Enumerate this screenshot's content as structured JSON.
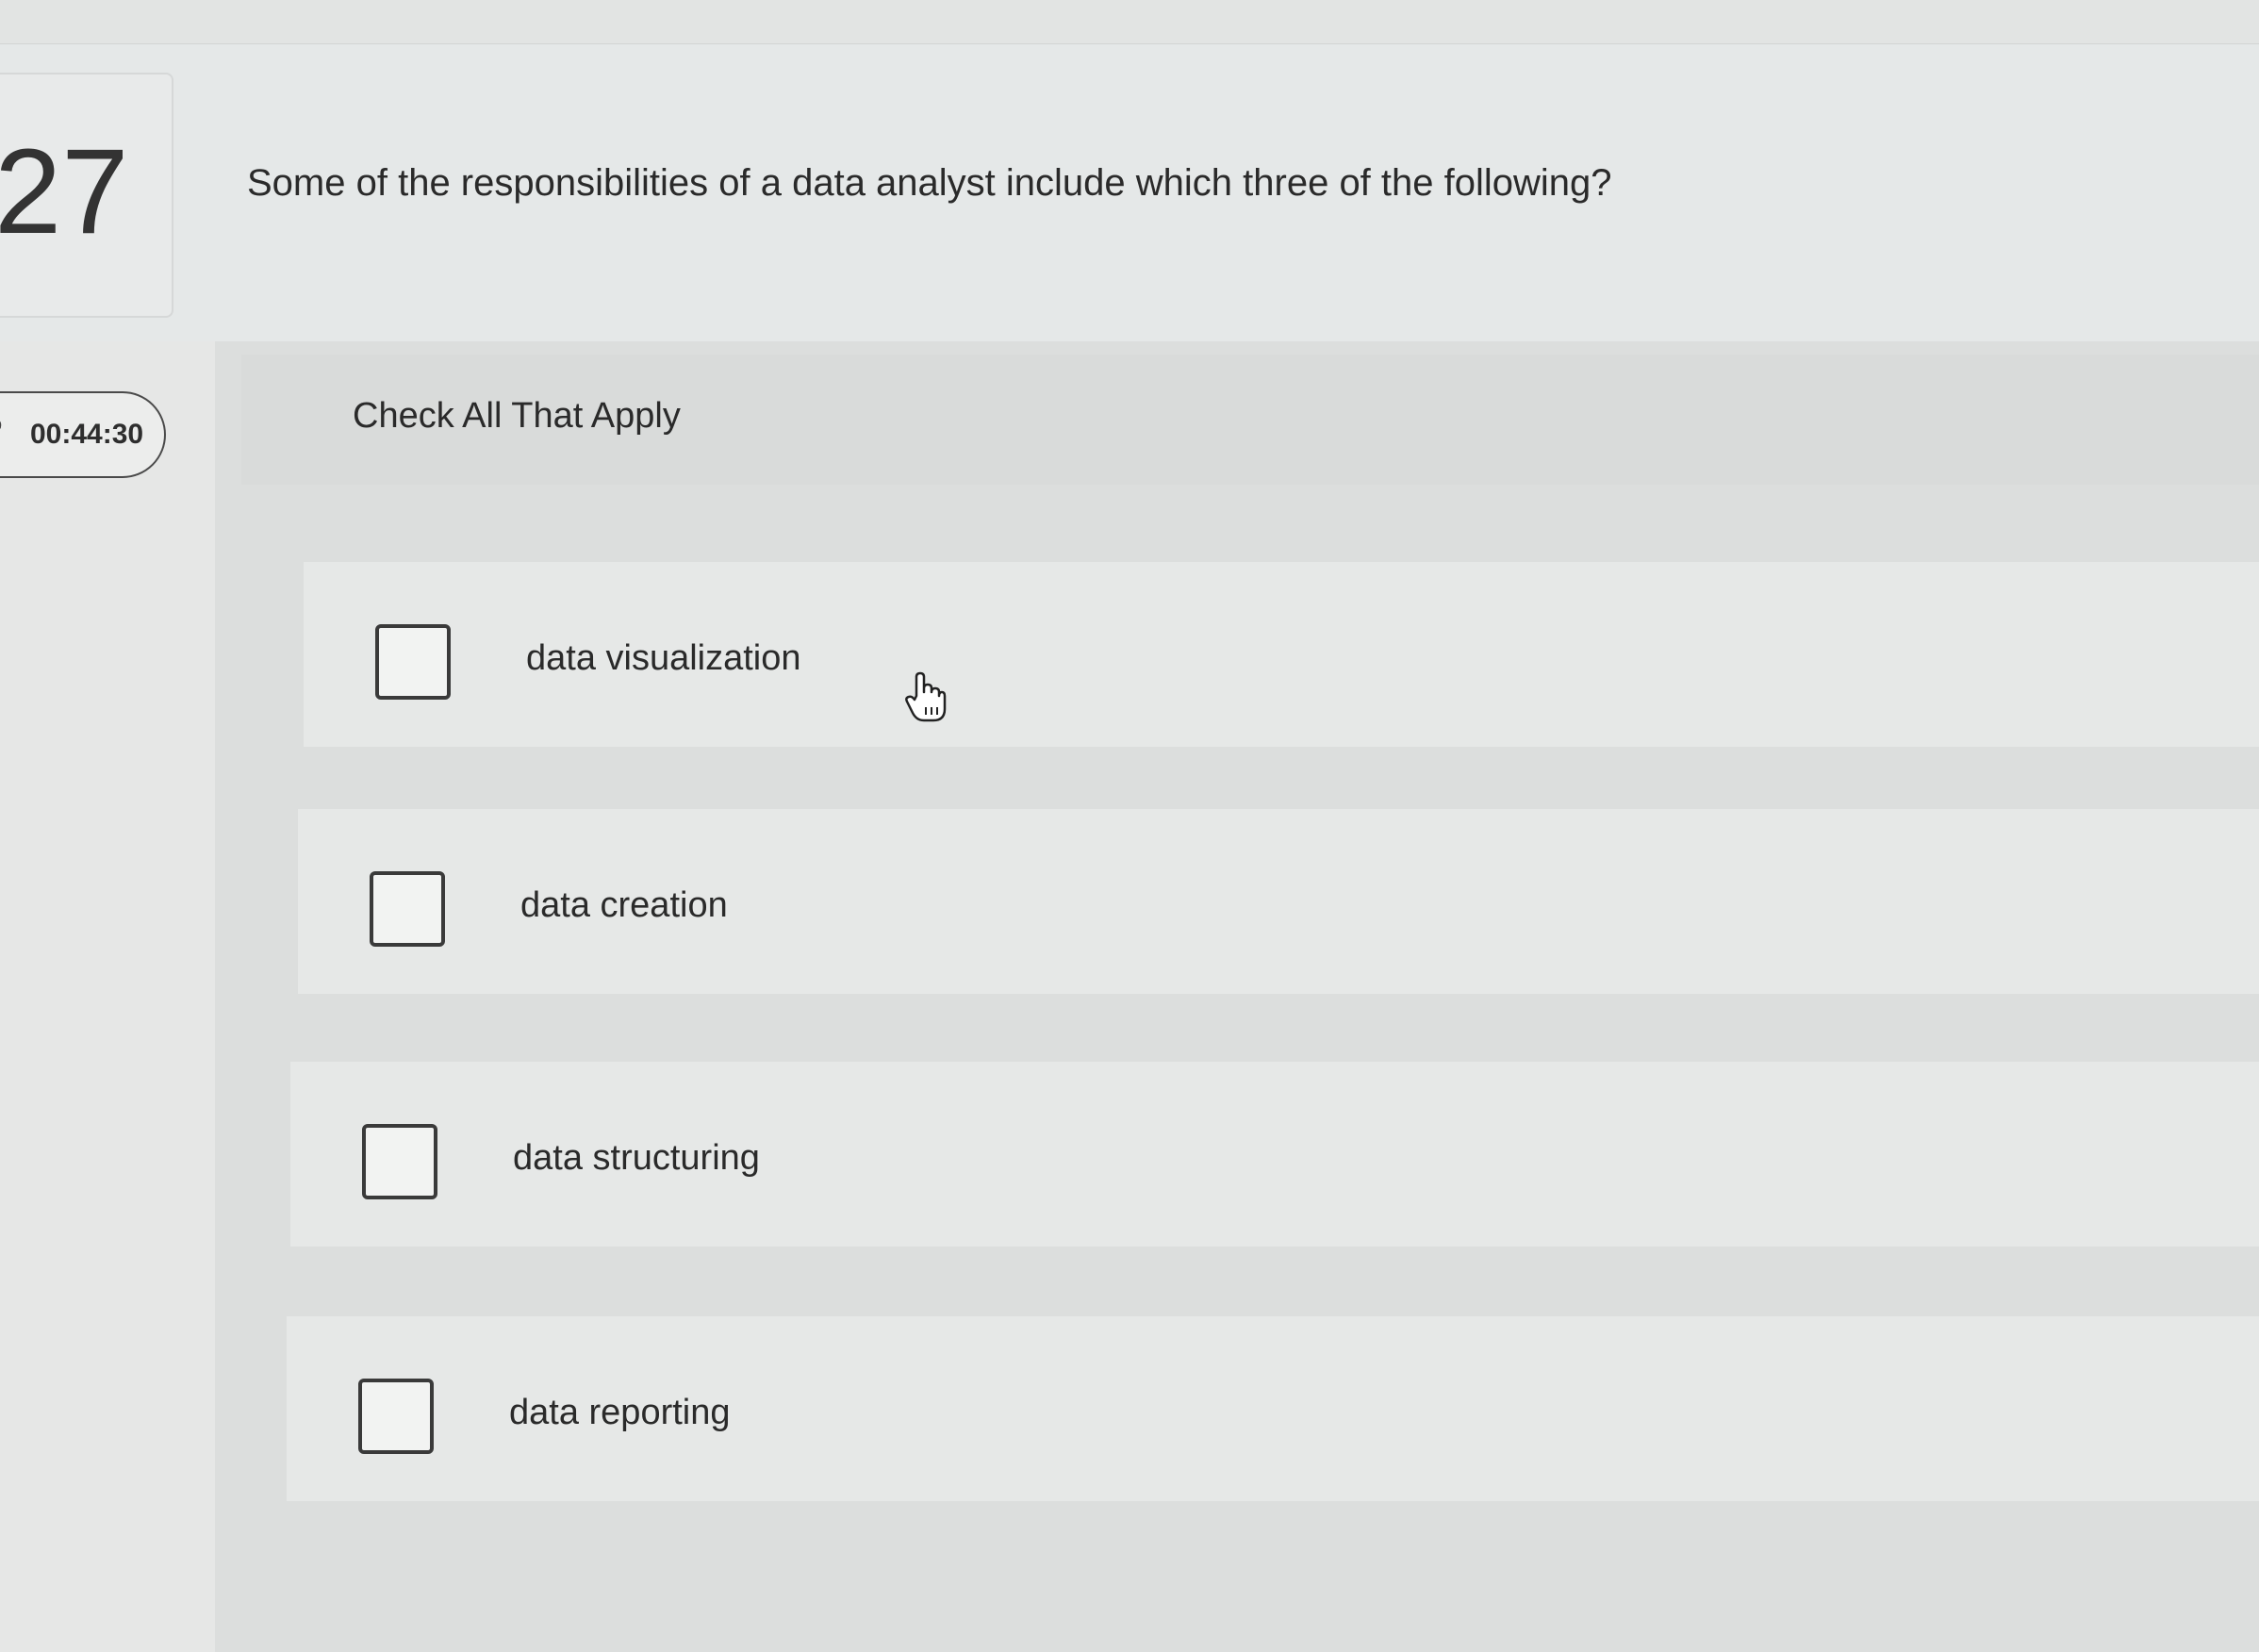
{
  "question": {
    "number": "27",
    "text": "Some of the responsibilities of a data analyst include which three of the following?"
  },
  "timer": {
    "value": "00:44:30"
  },
  "instructions": "Check All That Apply",
  "options": [
    {
      "label": "data visualization",
      "checked": false
    },
    {
      "label": "data creation",
      "checked": false
    },
    {
      "label": "data structuring",
      "checked": false
    },
    {
      "label": "data reporting",
      "checked": false
    }
  ],
  "cursor": {
    "icon": "hand-pointer-icon"
  }
}
